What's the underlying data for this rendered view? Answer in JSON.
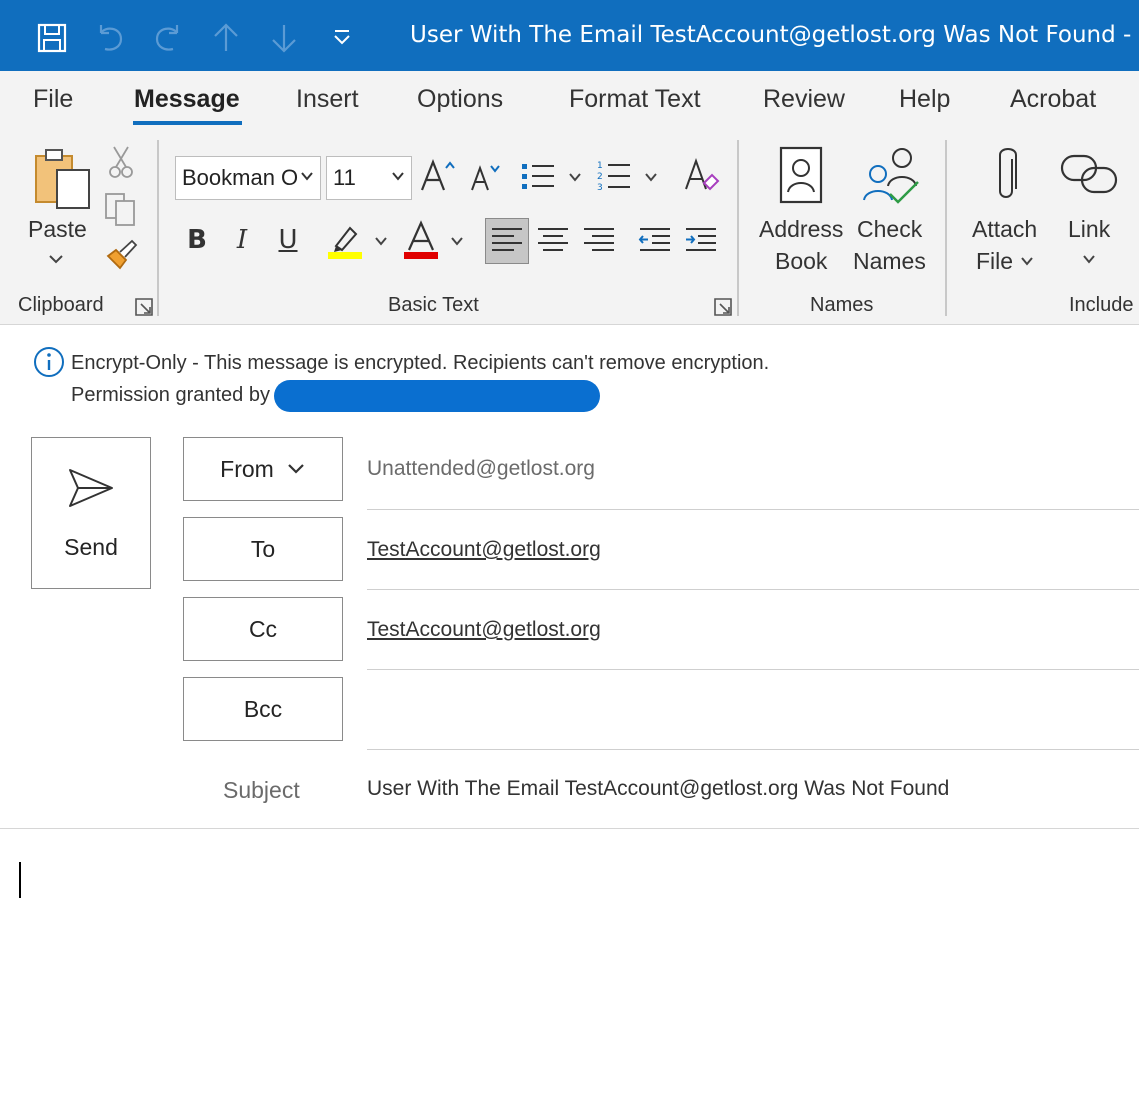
{
  "window": {
    "title": "User With The Email TestAccount@getlost.org Was Not Found  -  Me"
  },
  "quick_access": [
    {
      "name": "save-icon"
    },
    {
      "name": "undo-icon"
    },
    {
      "name": "redo-icon"
    },
    {
      "name": "up-arrow-icon"
    },
    {
      "name": "down-arrow-icon"
    },
    {
      "name": "customize-toolbar-icon"
    }
  ],
  "tabs": [
    "File",
    "Message",
    "Insert",
    "Options",
    "Format Text",
    "Review",
    "Help",
    "Acrobat"
  ],
  "active_tab": "Message",
  "ribbon": {
    "clipboard": {
      "paste_label": "Paste",
      "group_label": "Clipboard"
    },
    "basic_text": {
      "font_name": "Bookman O",
      "font_size": "11",
      "bold": "B",
      "italic": "I",
      "underline": "U",
      "group_label": "Basic Text",
      "highlight_color": "#ffff00",
      "font_color": "#e00000"
    },
    "names": {
      "address_book_line1": "Address",
      "address_book_line2": "Book",
      "check_names_line1": "Check",
      "check_names_line2": "Names",
      "group_label": "Names"
    },
    "include": {
      "attach_file_line1": "Attach",
      "attach_file_line2": "File",
      "link_label": "Link",
      "group_label": "Include"
    }
  },
  "info_bar": {
    "line1": "Encrypt-Only - This message is encrypted. Recipients can't remove encryption.",
    "line2": "Permission granted by"
  },
  "compose": {
    "send_label": "Send",
    "from_label": "From",
    "from_value": "Unattended@getlost.org",
    "to_label": "To",
    "to_value": "TestAccount@getlost.org",
    "cc_label": "Cc",
    "cc_value": "TestAccount@getlost.org",
    "bcc_label": "Bcc",
    "bcc_value": "",
    "subject_label": "Subject",
    "subject_value": "User With The Email TestAccount@getlost.org Was Not Found"
  },
  "colors": {
    "title_bar": "#106ebe",
    "accent": "#106ebe",
    "redaction": "#0a6fd0"
  }
}
